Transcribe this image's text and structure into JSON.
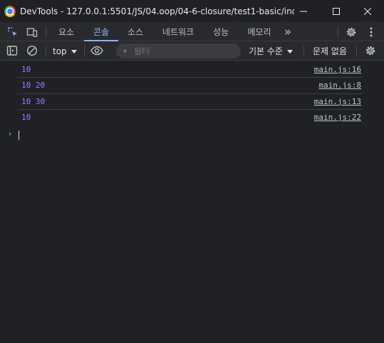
{
  "window": {
    "title": "DevTools - 127.0.0.1:5501/JS/04.oop/04-6-closure/test1-basic/index...",
    "icons": [
      "chrome-logo",
      "minimize-icon",
      "maximize-icon",
      "close-icon"
    ]
  },
  "tabs": [
    {
      "label": "요소",
      "active": false
    },
    {
      "label": "콘솔",
      "active": true
    },
    {
      "label": "소스",
      "active": false
    },
    {
      "label": "네트워크",
      "active": false
    },
    {
      "label": "성능",
      "active": false
    },
    {
      "label": "메모리",
      "active": false
    }
  ],
  "tabbar": {
    "more_label": "»",
    "icons": [
      "inspect-element-icon",
      "device-toolbar-icon",
      "settings-icon",
      "more-options-icon"
    ]
  },
  "console_toolbar": {
    "context": "top",
    "filter_placeholder": "필터",
    "levels": "기본 수준",
    "issues": "문제 없음",
    "icons": [
      "sidebar-toggle-icon",
      "clear-console-icon",
      "eye-icon",
      "filter-icon",
      "console-settings-icon"
    ]
  },
  "messages": [
    {
      "text": "10",
      "source": "main.js:16"
    },
    {
      "text": "10 20",
      "source": "main.js:8"
    },
    {
      "text": "10 30",
      "source": "main.js:13"
    },
    {
      "text": "10",
      "source": "main.js:22"
    }
  ],
  "prompt_symbol": "›",
  "colors": {
    "background": "#202124",
    "toolbar": "#292a2d",
    "accent": "#8ab4f8",
    "value": "#9980ff",
    "text": "#e3e3e3"
  }
}
